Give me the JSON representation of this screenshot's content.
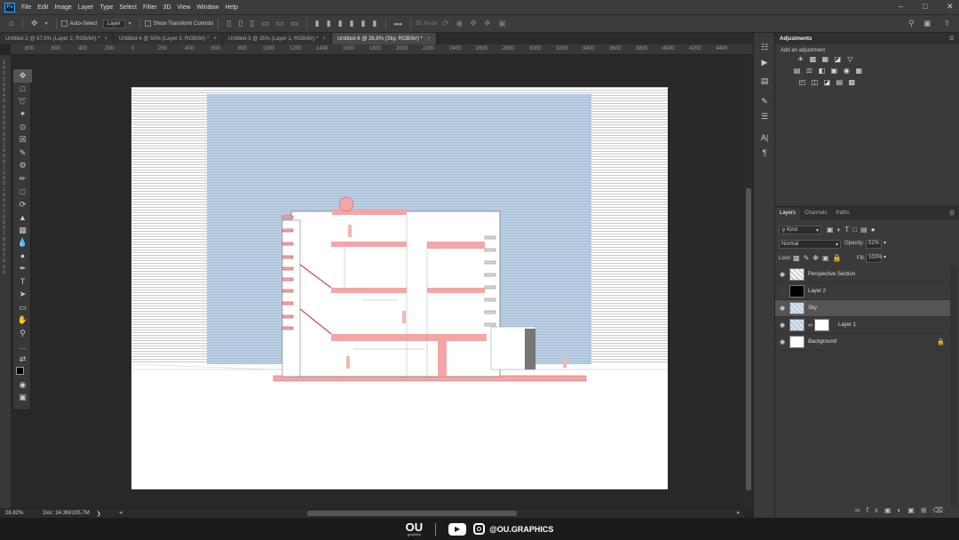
{
  "app": {
    "logo": "Ps",
    "menu": [
      "File",
      "Edit",
      "Image",
      "Layer",
      "Type",
      "Select",
      "Filter",
      "3D",
      "View",
      "Window",
      "Help"
    ]
  },
  "options": {
    "auto_select_label": "Auto-Select",
    "auto_select_target": "Layer",
    "show_transform_label": "Show Transform Controls",
    "mode_3d_label": "3D Mode:"
  },
  "tabs": [
    {
      "label": "Untitled-2 @ 67.5% (Layer 2, RGB/8#) *",
      "active": false
    },
    {
      "label": "Untitled-4 @ 50% (Layer 2, RGB/8#) *",
      "active": false
    },
    {
      "label": "Untitled-5 @ 25% (Layer 1, RGB/8#) *",
      "active": false
    },
    {
      "label": "Untitled-6 @ 26.8% (Sky, RGB/8#) *",
      "active": true
    }
  ],
  "ruler_top": [
    "800",
    "600",
    "400",
    "200",
    "0",
    "200",
    "400",
    "600",
    "800",
    "1000",
    "1200",
    "1400",
    "1600",
    "1800",
    "2000",
    "2200",
    "2400",
    "2600",
    "2800",
    "3000",
    "3200",
    "3400",
    "3600",
    "3800",
    "4000",
    "4200",
    "4400"
  ],
  "ruler_left": [
    "2",
    "0",
    "0",
    "2",
    "0",
    "0",
    "4",
    "0",
    "0",
    "6",
    "0",
    "0",
    "8",
    "0",
    "0",
    "1",
    "0",
    "0",
    "0",
    "1",
    "2",
    "0",
    "0",
    "1",
    "4",
    "0",
    "0",
    "1",
    "6",
    "0",
    "0",
    "1",
    "8",
    "0",
    "0",
    "2",
    "0",
    "0",
    "0"
  ],
  "status": {
    "zoom": "26.82%",
    "doc": "Doc: 34.3M/105.7M"
  },
  "adjustments": {
    "title": "Adjustments",
    "subtitle": "Add an adjustment"
  },
  "layers_panel": {
    "tabs": [
      {
        "label": "Layers",
        "active": true
      },
      {
        "label": "Channels",
        "active": false
      },
      {
        "label": "Paths",
        "active": false
      }
    ],
    "filter_kind": "Kind",
    "blend_mode": "Normal",
    "opacity_label": "Opacity:",
    "opacity_value": "51%",
    "lock_label": "Lock:",
    "fill_label": "Fill:",
    "fill_value": "100%",
    "layers": [
      {
        "name": "Perspective Section",
        "visible": true,
        "selected": false
      },
      {
        "name": "Layer 2",
        "visible": false,
        "selected": false
      },
      {
        "name": "Sky",
        "visible": true,
        "selected": true
      },
      {
        "name": "Layer 1",
        "visible": true,
        "selected": false
      },
      {
        "name": "Background",
        "visible": true,
        "selected": false
      }
    ]
  },
  "branding": {
    "logo_text": "OU",
    "logo_sub": "graphics",
    "handle": "@OU.GRAPHICS"
  },
  "colors": {
    "sky": "#b7cde2",
    "building_accent": "#f4a6a6",
    "selection": "#555555"
  }
}
